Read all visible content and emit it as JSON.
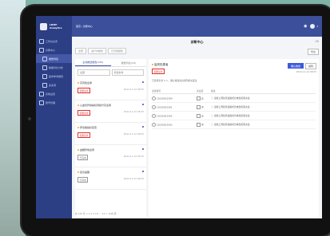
{
  "brand": {
    "line1": "LRMP",
    "line2": "Analytics"
  },
  "topbar": {
    "breadcrumb": "首页 / 诊断中心"
  },
  "sidebar": {
    "items": [
      {
        "label": "工作台总览",
        "sub": false,
        "active": false
      },
      {
        "label": "诊断中心",
        "sub": false,
        "active": false
      },
      {
        "label": "报告列表",
        "sub": true,
        "active": true
      },
      {
        "label": "数据对比分析",
        "sub": true,
        "active": false
      },
      {
        "label": "医学参考规则",
        "sub": true,
        "active": false
      },
      {
        "label": "多来源",
        "sub": true,
        "active": false
      },
      {
        "label": "系统设置",
        "sub": false,
        "active": false
      },
      {
        "label": "账号管理",
        "sub": false,
        "active": false
      }
    ]
  },
  "main": {
    "title": "诊断中心",
    "count": "25",
    "filters": [
      "全部",
      "进行中报告",
      "已归档报告"
    ],
    "export_label": "导出"
  },
  "left": {
    "tabs": [
      "主动推送报告(125)",
      "报告列表(18)"
    ],
    "selects": [
      "全部",
      "筛选条件"
    ],
    "items": [
      {
        "title": "高风险患者",
        "tag": "需要复查",
        "date": "2022-11-12 08:35",
        "tag_style": "red"
      },
      {
        "title": "心血管异常指标持续升高患者",
        "tag": "需要复查",
        "date": "2022-11-12 08:35",
        "tag_style": "red"
      },
      {
        "title": "肝功能指标复查",
        "tag": "需要复查",
        "date": "2022-11-12 08:35",
        "tag_style": "red"
      },
      {
        "title": "血糖异常患者",
        "tag": "已完成",
        "date": "2022-11-12 08:35",
        "tag_style": "grey"
      },
      {
        "title": "复诊提醒",
        "tag": "已完成",
        "date": "2022-11-12 08:35",
        "tag_style": "grey"
      }
    ],
    "pagination": "共 125 条 < 1 2 3 4 5 ... 13 > 10条/页"
  },
  "right": {
    "title": "高风险患者",
    "tag": "需要复查",
    "primary_label": "确认推送",
    "secondary_label": "编辑",
    "date": "2022-11-12 08:35",
    "subtitle": "已选择患者 4 人，确认推送后将通知相关医生",
    "columns": [
      "患者编号",
      "关注度",
      "备注"
    ],
    "rows": [
      {
        "id": "11020012300",
        "level": "高",
        "note": "患者上周复查后指标仍未改善需关注"
      },
      {
        "id": "11020012301",
        "level": "中",
        "note": "患者上周复查后指标仍未改善需关注"
      },
      {
        "id": "11020012302",
        "level": "高",
        "note": "患者上周复查后指标仍未改善需关注"
      },
      {
        "id": "11020012303",
        "level": "中",
        "note": "患者上周复查后指标仍未改善需关注"
      }
    ]
  }
}
